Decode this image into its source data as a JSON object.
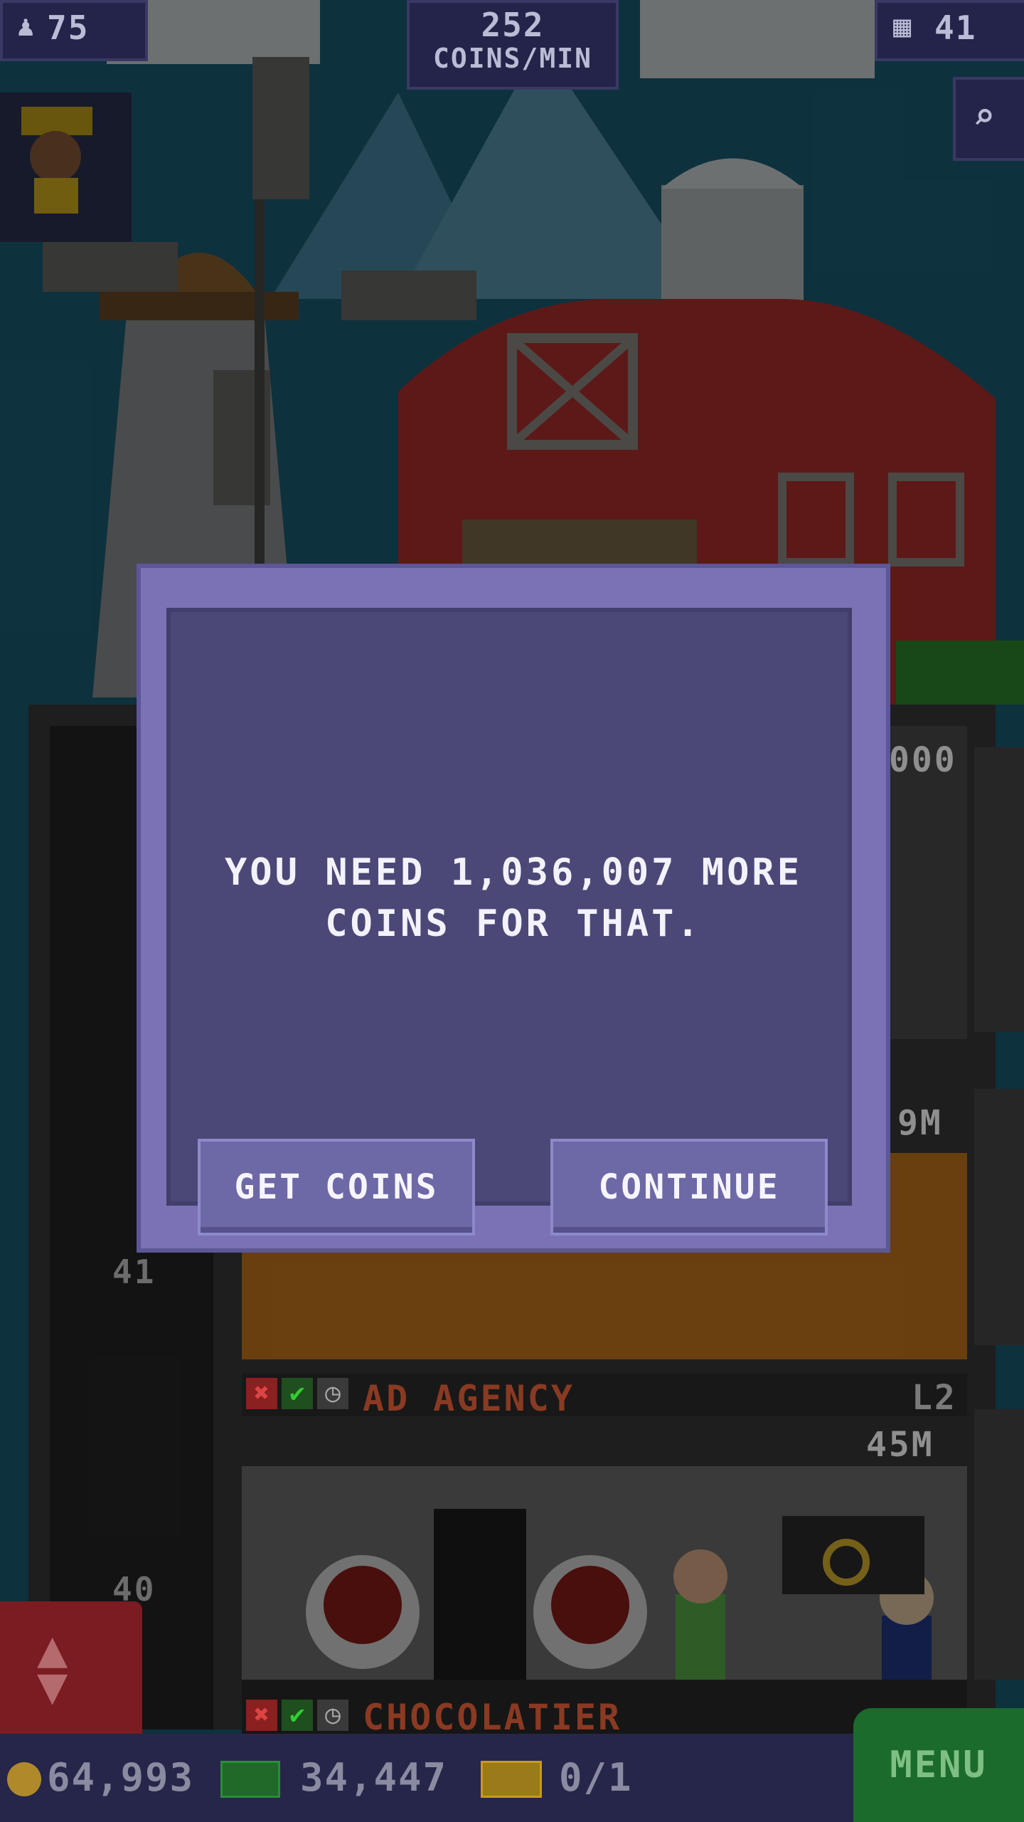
{
  "hud": {
    "population": "75",
    "rate_value": "252",
    "rate_unit": "COINS/MIN",
    "floors": "41"
  },
  "dialog": {
    "message_line1": "YOU NEED 1,036,007 MORE",
    "message_line2": "COINS FOR THAT.",
    "get_coins_label": "GET COINS",
    "continue_label": "CONTINUE"
  },
  "tower": {
    "floor_a_price": "000",
    "floor_b_price": "9M",
    "floor_c_name": "AD AGENCY",
    "floor_c_level": "L2",
    "floor_c_price": "45M",
    "floor_d_name": "CHOCOLATIER",
    "elevator_floor_1": "41",
    "elevator_floor_2": "40"
  },
  "bottom_bar": {
    "coins": "64,993",
    "bux": "34,447",
    "tickets": "0/1",
    "menu_label": "MENU"
  },
  "colors": {
    "sky": "#1c5f78",
    "dialog_outer": "#7a72b4",
    "dialog_inner": "#4b4877",
    "button": "#6d68a6",
    "menu_green": "#1b6b2c"
  }
}
